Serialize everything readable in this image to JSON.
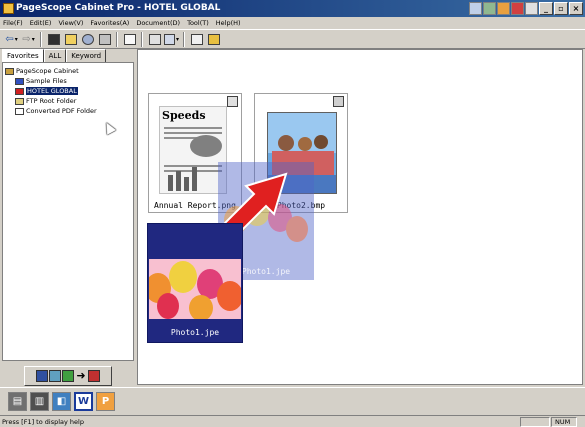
{
  "window": {
    "title": "PageScope Cabinet Pro - HOTEL GLOBAL",
    "controls": [
      "minimize",
      "restore",
      "close"
    ]
  },
  "menubar": [
    "File(F)",
    "Edit(E)",
    "View(V)",
    "Favorites(A)",
    "Document(D)",
    "Tool(T)",
    "Help(H)"
  ],
  "toolbar_icons": [
    "back-icon",
    "forward-icon",
    "cabinet-icon",
    "folder-icon",
    "sync-icon",
    "print-icon",
    "blank-page-icon",
    "list-view-icon",
    "thumbnail-view-icon",
    "properties-icon",
    "settings-icon"
  ],
  "left_panel": {
    "tabs": [
      "Favorites",
      "ALL",
      "Keyword"
    ],
    "active_tab": "Favorites",
    "tree": {
      "root": "PageScope Cabinet",
      "children": [
        "Sample Files",
        "HOTEL GLOBAL",
        "FTP Root Folder",
        "Converted PDF Folder"
      ],
      "selected": "HOTEL GLOBAL"
    }
  },
  "main": {
    "thumbnails": [
      {
        "caption": "Annual Report.png",
        "newspaper_title": "Speeds"
      },
      {
        "caption": "Photo2.bmp"
      },
      {
        "caption": "Photo1.jpe"
      },
      {
        "caption": "Photo1.jpe"
      }
    ]
  },
  "device_bar": [
    "scanner-icon",
    "copier-icon",
    "fax-icon",
    "word-icon",
    "powerpoint-icon"
  ],
  "device_labels": {
    "word": "W",
    "ppt": "P"
  },
  "statusbar": {
    "message": "Press [F1] to display help",
    "num": "NUM"
  }
}
